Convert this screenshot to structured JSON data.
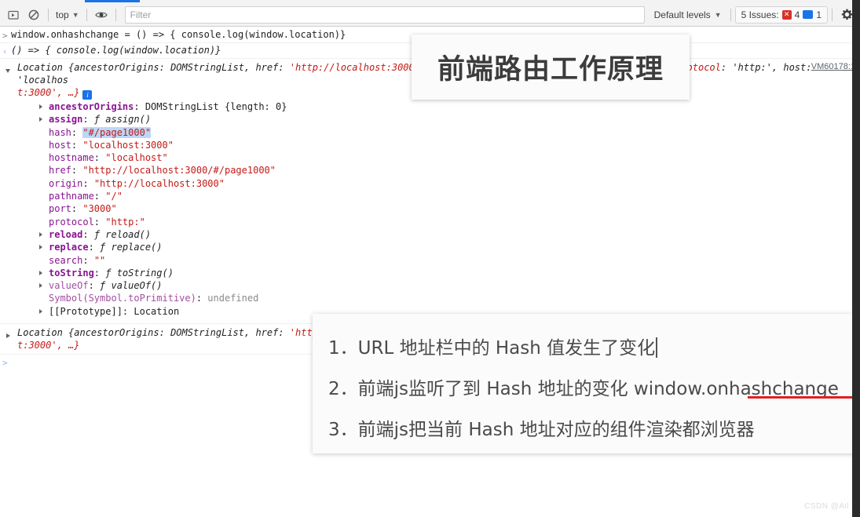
{
  "toolbar": {
    "sidebar_toggle_label": "▶",
    "clear_label": "⃠",
    "context_label": "top",
    "context_caret": "▼",
    "eye_label": "◉",
    "filter_placeholder": "Filter",
    "levels_label": "Default levels",
    "levels_caret": "▼",
    "issues_label": "5 Issues:",
    "issues_error_glyph": "✕",
    "issues_error_count": "4",
    "issues_info_glyph": "▬",
    "issues_info_count": "1",
    "settings_label": "⚙"
  },
  "console": {
    "input_prompt": ">",
    "input_line": "window.onhashchange = () => { console.log(window.location)}",
    "result_prompt": "‹",
    "result_line": "() => { console.log(window.location)}",
    "log1": {
      "head_a": "Location ",
      "head_b": "{ancestorOrigins: ",
      "head_c": "DOMStringList",
      "head_d": ", href: ",
      "head_e": "'http://localhost:3000/#/page1000', ancestorOrigins: DOMStringList, protocol",
      "head_f": ": 'http:', host: 'localhos",
      "head_wrap": "t:3000', …}",
      "info_glyph": "i",
      "vm_link": "VM60178:1",
      "properties": [
        {
          "expandable": true,
          "name": "ancestorOrigins",
          "sep": ": ",
          "value": "DOMStringList {length: 0}",
          "kind": "plain",
          "bold": true
        },
        {
          "expandable": true,
          "name": "assign",
          "sep": ": ",
          "value": "ƒ assign()",
          "kind": "fn",
          "bold": true
        },
        {
          "expandable": false,
          "name": "hash",
          "sep": ": ",
          "value": "\"#/page1000\"",
          "kind": "str",
          "selected": true
        },
        {
          "expandable": false,
          "name": "host",
          "sep": ": ",
          "value": "\"localhost:3000\"",
          "kind": "str"
        },
        {
          "expandable": false,
          "name": "hostname",
          "sep": ": ",
          "value": "\"localhost\"",
          "kind": "str"
        },
        {
          "expandable": false,
          "name": "href",
          "sep": ": ",
          "value": "\"http://localhost:3000/#/page1000\"",
          "kind": "str"
        },
        {
          "expandable": false,
          "name": "origin",
          "sep": ": ",
          "value": "\"http://localhost:3000\"",
          "kind": "str"
        },
        {
          "expandable": false,
          "name": "pathname",
          "sep": ": ",
          "value": "\"/\"",
          "kind": "str"
        },
        {
          "expandable": false,
          "name": "port",
          "sep": ": ",
          "value": "\"3000\"",
          "kind": "str"
        },
        {
          "expandable": false,
          "name": "protocol",
          "sep": ": ",
          "value": "\"http:\"",
          "kind": "str"
        },
        {
          "expandable": true,
          "name": "reload",
          "sep": ": ",
          "value": "ƒ reload()",
          "kind": "fn",
          "bold": true
        },
        {
          "expandable": true,
          "name": "replace",
          "sep": ": ",
          "value": "ƒ replace()",
          "kind": "fn",
          "bold": true
        },
        {
          "expandable": false,
          "name": "search",
          "sep": ": ",
          "value": "\"\"",
          "kind": "str"
        },
        {
          "expandable": true,
          "name": "toString",
          "sep": ": ",
          "value": "ƒ toString()",
          "kind": "fn",
          "bold": true
        },
        {
          "expandable": true,
          "name": "valueOf",
          "sep": ": ",
          "value": "ƒ valueOf()",
          "kind": "fn",
          "dim": true
        },
        {
          "expandable": false,
          "name": "Symbol(Symbol.toPrimitive)",
          "sep": ": ",
          "value": "undefined",
          "kind": "undef",
          "dim": true
        },
        {
          "expandable": true,
          "name": "[[Prototype]]",
          "sep": ": ",
          "value": "Location",
          "kind": "plain",
          "proto": true
        }
      ]
    },
    "log2": {
      "head_a": "Location ",
      "head_b": "{ancestorOrigins: ",
      "head_c": "DOMStringList",
      "head_d": ", href: ",
      "head_e": "'http://localhost:3000/#/page1000', ancestorOrigins:",
      "head_wrap": "t:3000', …}"
    },
    "final_prompt": ">"
  },
  "overlays": {
    "title": "前端路由工作原理",
    "steps": [
      "1．URL 地址栏中的 Hash 值发生了变化",
      "2．前端js监听了到 Hash 地址的变化 window.onhashchange",
      "3．前端js把当前 Hash 地址对应的组件渲染都浏览器"
    ]
  },
  "watermark": "CSDN @Ail",
  "colors": {
    "accent": "#1a73e8",
    "error": "#d93025",
    "string": "#c41a16",
    "property": "#881391",
    "underline": "#e02020"
  }
}
